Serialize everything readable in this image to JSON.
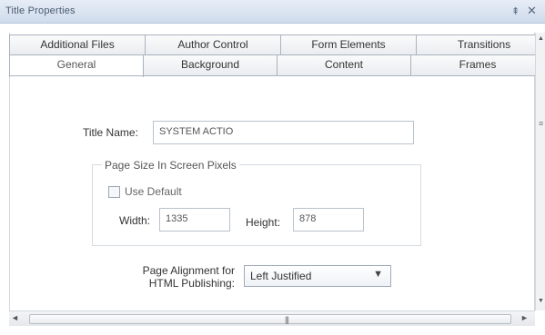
{
  "window": {
    "title": "Title Properties",
    "pin_glyph": "⇞",
    "close_glyph": "✕"
  },
  "tabs": {
    "back_row": [
      "Additional Files",
      "Author Control",
      "Form Elements",
      "Transitions"
    ],
    "front_row": [
      "General",
      "Background",
      "Content",
      "Frames"
    ],
    "active": "General"
  },
  "form": {
    "title_name_label": "Title Name:",
    "title_name_value": "SYSTEM ACTIO",
    "page_size_legend": "Page Size In Screen Pixels",
    "use_default_label": "Use Default",
    "use_default_checked": false,
    "width_label": "Width:",
    "width_value": "1335",
    "height_label": "Height:",
    "height_value": "878",
    "alignment_label_line1": "Page Alignment for",
    "alignment_label_line2": "HTML Publishing:",
    "alignment_value": "Left Justified"
  },
  "scroll": {
    "up_glyph": "▲",
    "down_glyph": "▼",
    "left_glyph": "◄",
    "right_glyph": "►",
    "grip": "|||"
  },
  "icons": {
    "dropdown_arrow": "▼"
  },
  "colors": {
    "titlebar_top": "#e6edf6",
    "titlebar_bottom": "#cfdbeb",
    "tab_border": "#a9b3c0"
  }
}
